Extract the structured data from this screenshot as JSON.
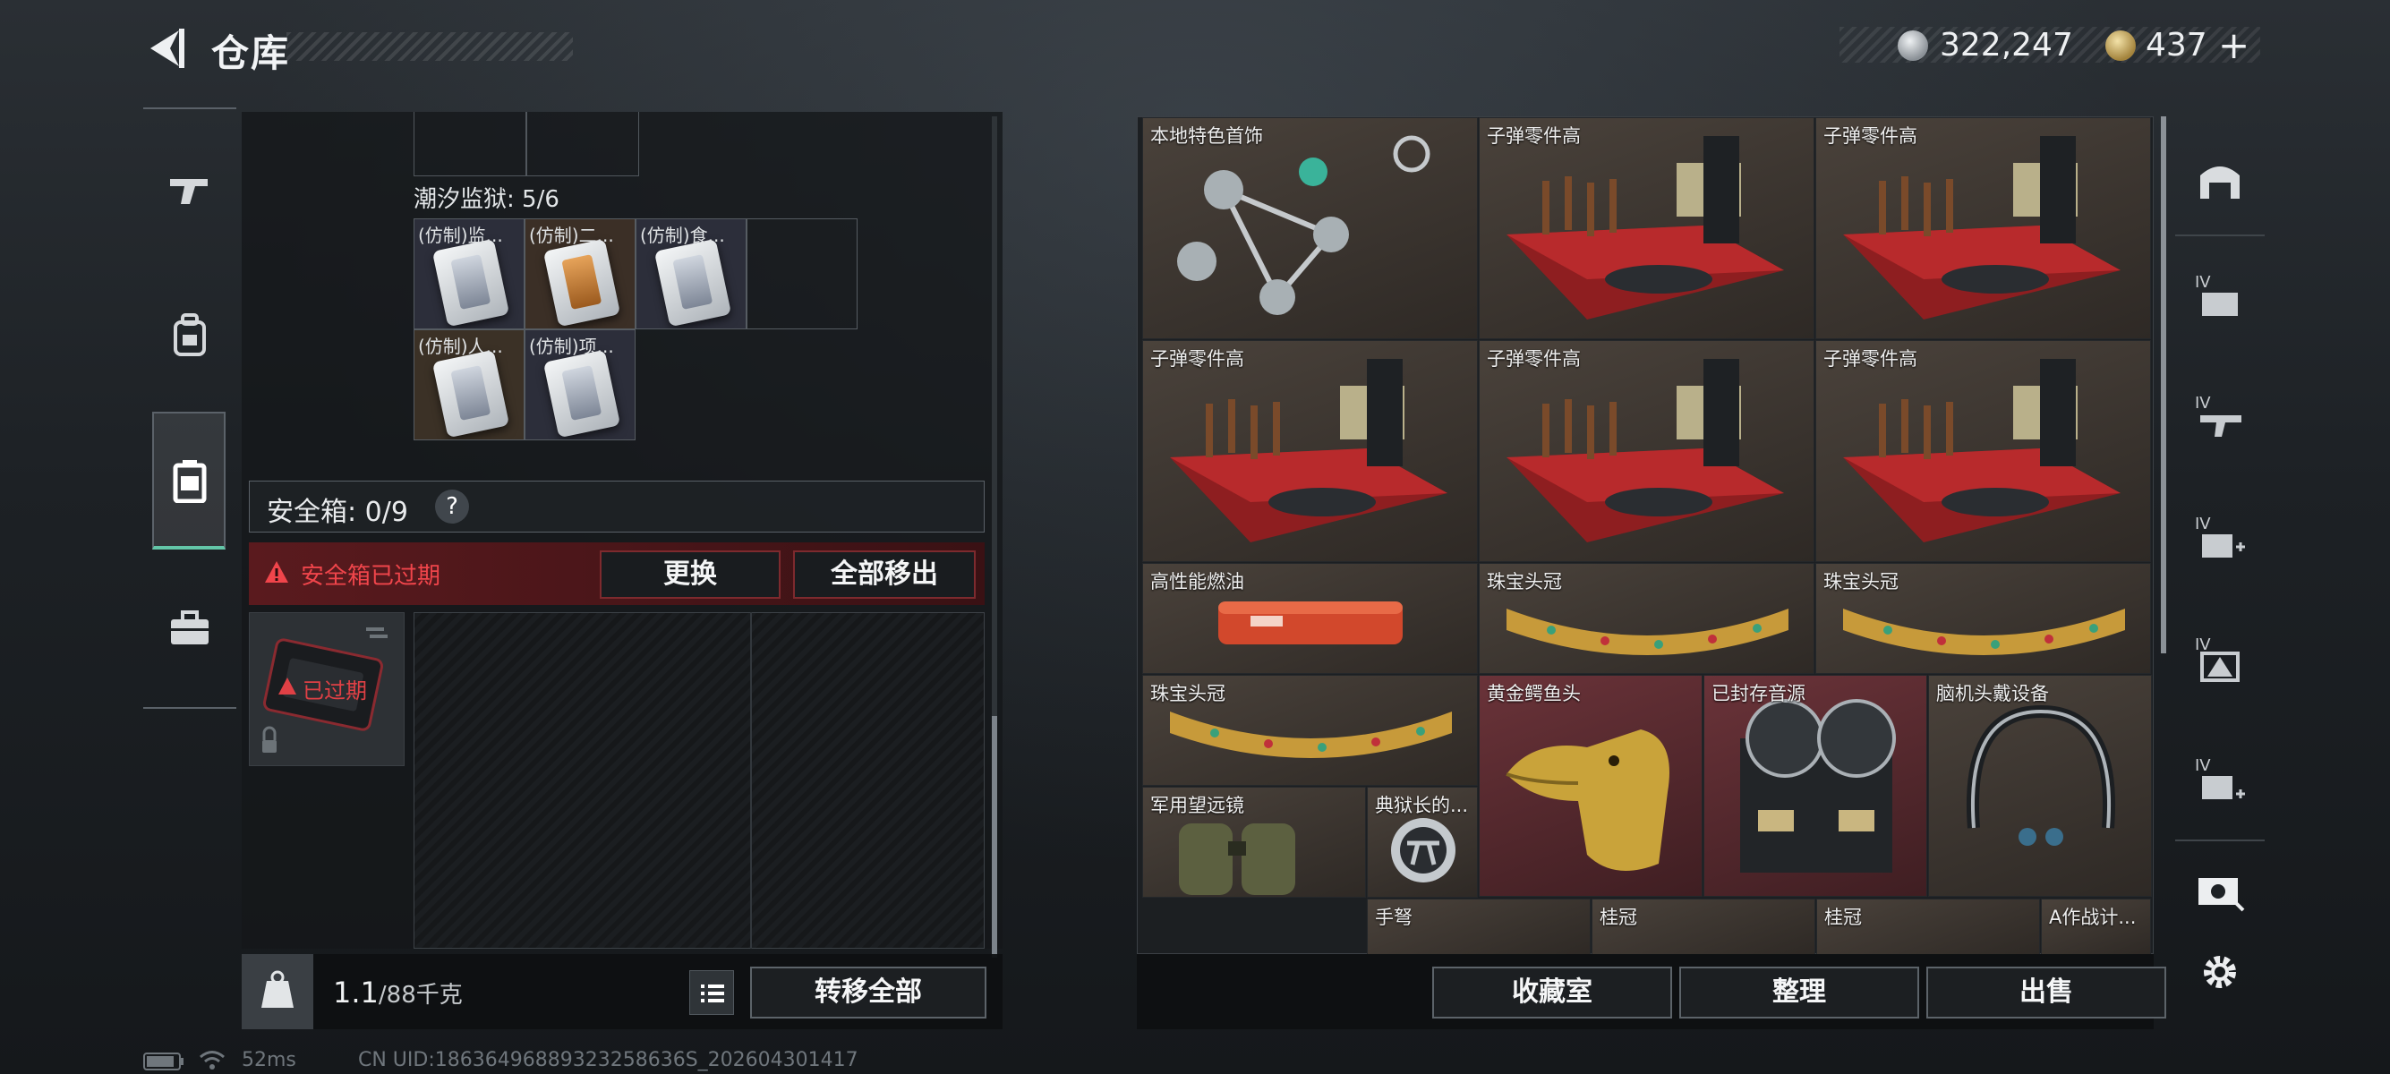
{
  "header": {
    "title": "仓库",
    "currency": [
      {
        "name": "silver-coin",
        "value": "322,247"
      },
      {
        "name": "gold-coin",
        "value": "437"
      }
    ],
    "plus_label": "+"
  },
  "left_nav": {
    "items": [
      {
        "icon": "gun-icon"
      },
      {
        "icon": "backpack-icon"
      },
      {
        "icon": "safebox-icon",
        "active": true
      },
      {
        "icon": "briefcase-icon"
      }
    ]
  },
  "container": {
    "prison_label": "潮汐监狱: 5/6",
    "items": [
      {
        "label": "(仿制)监..."
      },
      {
        "label": "(仿制)二..."
      },
      {
        "label": "(仿制)食..."
      },
      {
        "label": "(仿制)人..."
      },
      {
        "label": "(仿制)项..."
      }
    ]
  },
  "safe_box": {
    "label": "安全箱: 0/9",
    "help": "?",
    "expired_message": "安全箱已过期",
    "replace_label": "更换",
    "move_all_label": "全部移出",
    "expired_tag": "已过期"
  },
  "footer_left": {
    "weight": "1.1",
    "weight_cap": "/88千克",
    "transfer_label": "转移全部"
  },
  "stash": {
    "items": [
      {
        "label": "本地特色首饰",
        "art": "necklace"
      },
      {
        "label": "子弹零件高",
        "art": "ammo"
      },
      {
        "label": "子弹零件高",
        "art": "ammo"
      },
      {
        "label": "子弹零件高",
        "art": "ammo"
      },
      {
        "label": "子弹零件高",
        "art": "ammo"
      },
      {
        "label": "子弹零件高",
        "art": "ammo"
      },
      {
        "label": "高性能燃油",
        "art": "fuel"
      },
      {
        "label": "珠宝头冠",
        "art": "crown"
      },
      {
        "label": "珠宝头冠",
        "art": "crown"
      },
      {
        "label": "珠宝头冠",
        "art": "crown"
      },
      {
        "label": "黄金鳄鱼头",
        "art": "croc"
      },
      {
        "label": "已封存音源",
        "art": "tape"
      },
      {
        "label": "脑机头戴设备",
        "art": "headset"
      },
      {
        "label": "军用望远镜",
        "art": "binoculars"
      },
      {
        "label": "典狱长的...",
        "art": "badge"
      },
      {
        "label": "手弩",
        "art": "crossbow"
      },
      {
        "label": "桂冠",
        "art": "laurel"
      },
      {
        "label": "桂冠",
        "art": "laurel"
      },
      {
        "label": "A作战计...",
        "art": "plan"
      }
    ]
  },
  "footer_right": {
    "collect_label": "收藏室",
    "sort_label": "整理",
    "sell_label": "出售"
  },
  "right_nav": {
    "items": [
      {
        "icon": "vault-icon"
      },
      {
        "icon": "storage-iv-icon",
        "text": "IV"
      },
      {
        "icon": "weapon-iv-icon",
        "text": "IV"
      },
      {
        "icon": "medical-iv-icon",
        "text": "IV"
      },
      {
        "icon": "warning-iv-icon",
        "text": "IV"
      },
      {
        "icon": "expand-iv-icon",
        "text": "IV"
      },
      {
        "icon": "currency-icon"
      },
      {
        "icon": "settings-icon"
      }
    ]
  },
  "status_bar": {
    "ping": "52ms",
    "uid": "CN UID:18636496889323258636S_202604301417"
  },
  "colors": {
    "accent_green": "#63c6a8",
    "alert_red": "#f0454b",
    "item_bg": "#3a342e",
    "item_red_bg": "#5a2a2f"
  }
}
